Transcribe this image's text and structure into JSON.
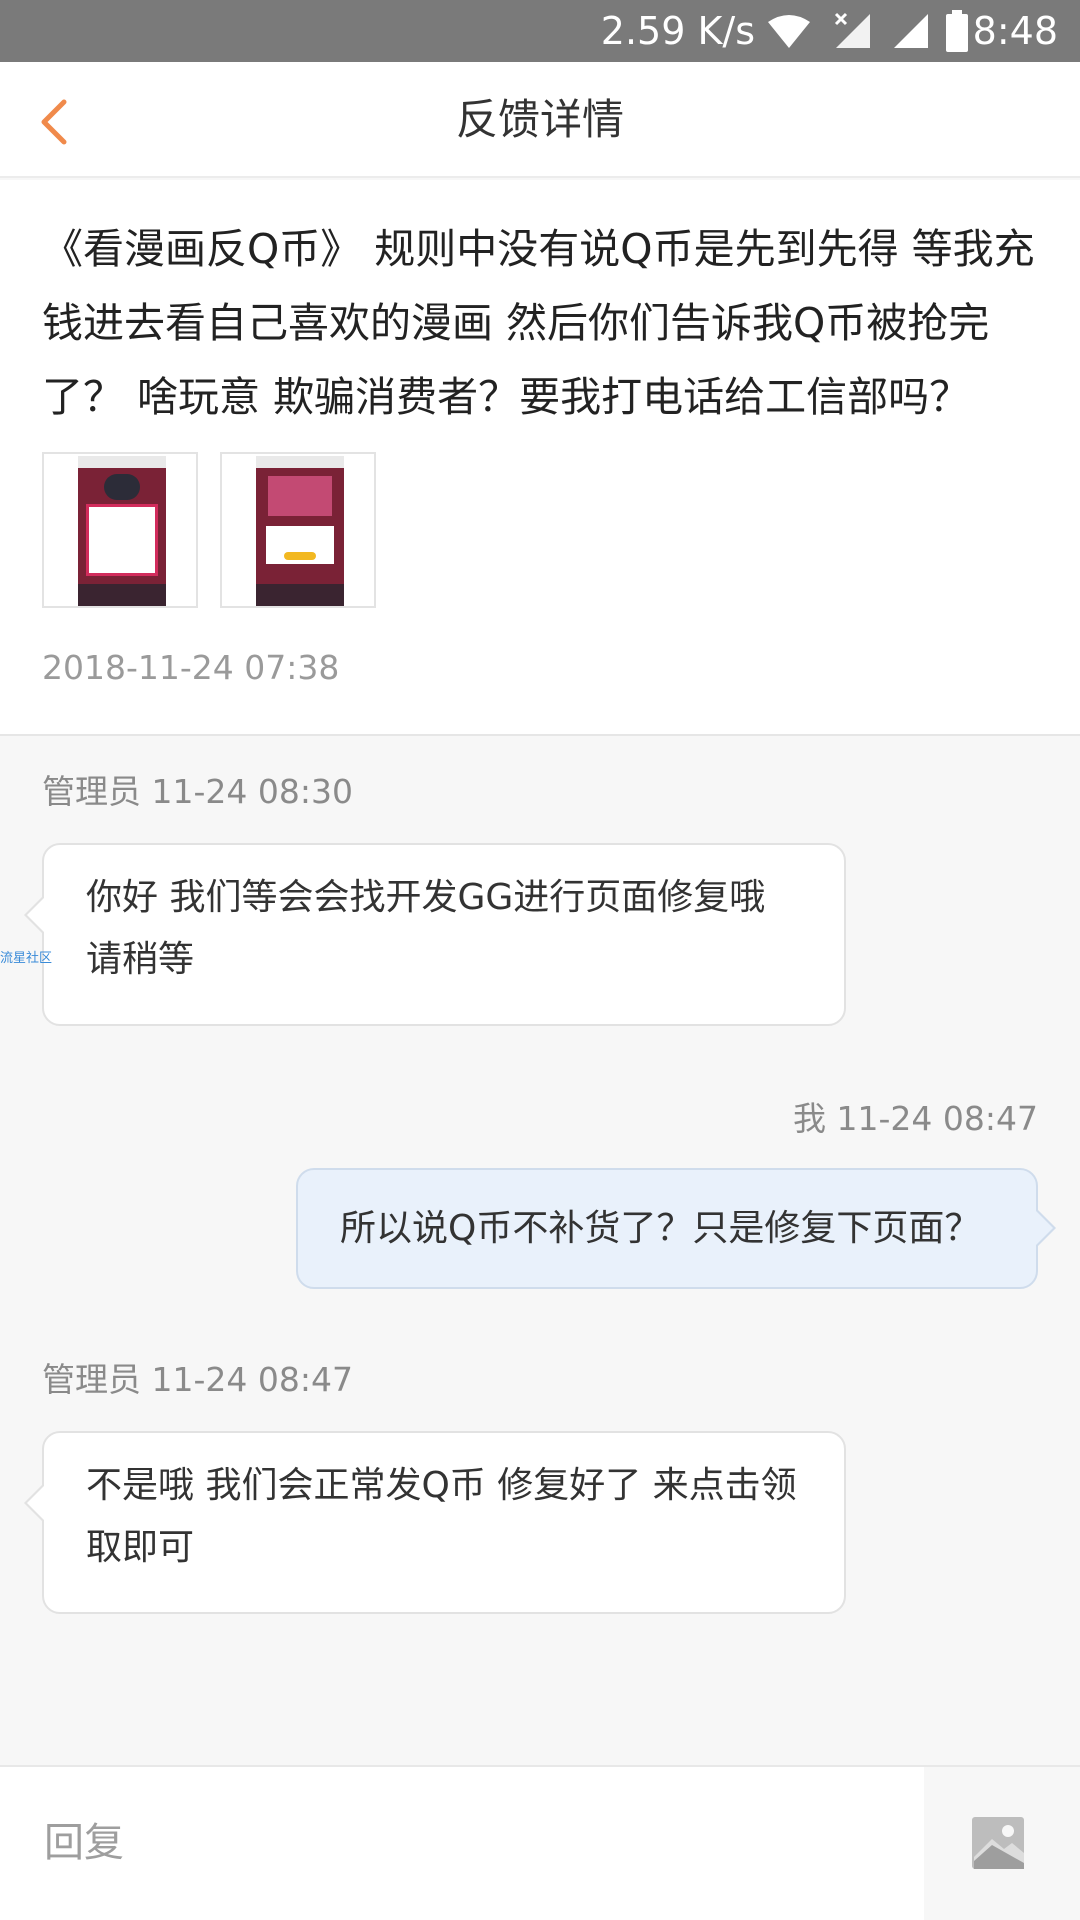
{
  "status_bar": {
    "network_speed": "2.59 K/s",
    "time": "8:48",
    "icons": [
      "wifi-icon",
      "signal-no-sim-icon",
      "signal-icon",
      "battery-icon"
    ]
  },
  "nav": {
    "title": "反馈详情",
    "back_icon": "chevron-left-icon",
    "accent_color": "#f08a4b"
  },
  "post": {
    "content": "《看漫画反Q币》 规则中没有说Q币是先到先得 等我充钱进去看自己喜欢的漫画 然后你们告诉我Q币被抢完了？ 啥玩意 欺骗消费者？要我打电话给工信部吗？",
    "attachments": [
      "screenshot-thumbnail-1",
      "screenshot-thumbnail-2"
    ],
    "time": "2018-11-24 07:38"
  },
  "messages": [
    {
      "meta": "管理员 11-24 08:30",
      "text": "你好 我们等会会找开发GG进行页面修复哦 请稍等",
      "side": "left"
    },
    {
      "meta": "我 11-24 08:47",
      "text": "所以说Q币不补货了？只是修复下页面？",
      "side": "right"
    },
    {
      "meta": "管理员 11-24 08:47",
      "text": "不是哦  我们会正常发Q币  修复好了  来点击领取即可",
      "side": "left"
    }
  ],
  "watermark": "流星社区",
  "reply": {
    "placeholder": "回复",
    "image_icon": "image-icon"
  }
}
